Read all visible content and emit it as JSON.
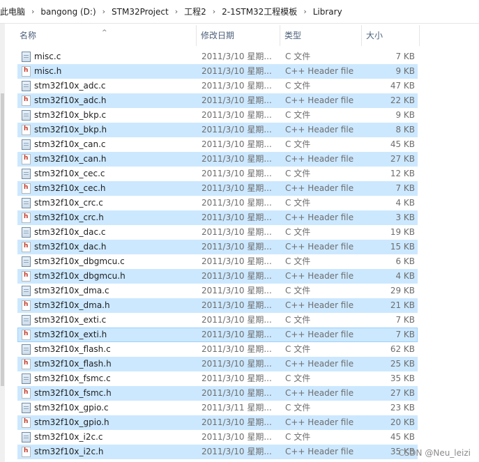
{
  "breadcrumb": [
    "此电脑",
    "bangong (D:)",
    "STM32Project",
    "工程2",
    "2-1STM32工程模板",
    "Library"
  ],
  "columns": {
    "name": "名称",
    "date": "修改日期",
    "type": "类型",
    "size": "大小"
  },
  "files": [
    {
      "name": "misc.c",
      "date": "2011/3/10 星期...",
      "type": "C 文件",
      "size": "7 KB",
      "kind": "c",
      "selected": false
    },
    {
      "name": "misc.h",
      "date": "2011/3/10 星期...",
      "type": "C++ Header file",
      "size": "9 KB",
      "kind": "h",
      "selected": true
    },
    {
      "name": "stm32f10x_adc.c",
      "date": "2011/3/10 星期...",
      "type": "C 文件",
      "size": "47 KB",
      "kind": "c",
      "selected": false
    },
    {
      "name": "stm32f10x_adc.h",
      "date": "2011/3/10 星期...",
      "type": "C++ Header file",
      "size": "22 KB",
      "kind": "h",
      "selected": true
    },
    {
      "name": "stm32f10x_bkp.c",
      "date": "2011/3/10 星期...",
      "type": "C 文件",
      "size": "9 KB",
      "kind": "c",
      "selected": false
    },
    {
      "name": "stm32f10x_bkp.h",
      "date": "2011/3/10 星期...",
      "type": "C++ Header file",
      "size": "8 KB",
      "kind": "h",
      "selected": true
    },
    {
      "name": "stm32f10x_can.c",
      "date": "2011/3/10 星期...",
      "type": "C 文件",
      "size": "45 KB",
      "kind": "c",
      "selected": false
    },
    {
      "name": "stm32f10x_can.h",
      "date": "2011/3/10 星期...",
      "type": "C++ Header file",
      "size": "27 KB",
      "kind": "h",
      "selected": true
    },
    {
      "name": "stm32f10x_cec.c",
      "date": "2011/3/10 星期...",
      "type": "C 文件",
      "size": "12 KB",
      "kind": "c",
      "selected": false
    },
    {
      "name": "stm32f10x_cec.h",
      "date": "2011/3/10 星期...",
      "type": "C++ Header file",
      "size": "7 KB",
      "kind": "h",
      "selected": true
    },
    {
      "name": "stm32f10x_crc.c",
      "date": "2011/3/10 星期...",
      "type": "C 文件",
      "size": "4 KB",
      "kind": "c",
      "selected": false
    },
    {
      "name": "stm32f10x_crc.h",
      "date": "2011/3/10 星期...",
      "type": "C++ Header file",
      "size": "3 KB",
      "kind": "h",
      "selected": true
    },
    {
      "name": "stm32f10x_dac.c",
      "date": "2011/3/10 星期...",
      "type": "C 文件",
      "size": "19 KB",
      "kind": "c",
      "selected": false
    },
    {
      "name": "stm32f10x_dac.h",
      "date": "2011/3/10 星期...",
      "type": "C++ Header file",
      "size": "15 KB",
      "kind": "h",
      "selected": true
    },
    {
      "name": "stm32f10x_dbgmcu.c",
      "date": "2011/3/10 星期...",
      "type": "C 文件",
      "size": "6 KB",
      "kind": "c",
      "selected": false
    },
    {
      "name": "stm32f10x_dbgmcu.h",
      "date": "2011/3/10 星期...",
      "type": "C++ Header file",
      "size": "4 KB",
      "kind": "h",
      "selected": true
    },
    {
      "name": "stm32f10x_dma.c",
      "date": "2011/3/10 星期...",
      "type": "C 文件",
      "size": "29 KB",
      "kind": "c",
      "selected": false
    },
    {
      "name": "stm32f10x_dma.h",
      "date": "2011/3/10 星期...",
      "type": "C++ Header file",
      "size": "21 KB",
      "kind": "h",
      "selected": true
    },
    {
      "name": "stm32f10x_exti.c",
      "date": "2011/3/10 星期...",
      "type": "C 文件",
      "size": "7 KB",
      "kind": "c",
      "selected": false
    },
    {
      "name": "stm32f10x_exti.h",
      "date": "2011/3/10 星期...",
      "type": "C++ Header file",
      "size": "7 KB",
      "kind": "h",
      "selected": true,
      "focused": true
    },
    {
      "name": "stm32f10x_flash.c",
      "date": "2011/3/10 星期...",
      "type": "C 文件",
      "size": "62 KB",
      "kind": "c",
      "selected": false
    },
    {
      "name": "stm32f10x_flash.h",
      "date": "2011/3/10 星期...",
      "type": "C++ Header file",
      "size": "25 KB",
      "kind": "h",
      "selected": true
    },
    {
      "name": "stm32f10x_fsmc.c",
      "date": "2011/3/10 星期...",
      "type": "C 文件",
      "size": "35 KB",
      "kind": "c",
      "selected": false
    },
    {
      "name": "stm32f10x_fsmc.h",
      "date": "2011/3/10 星期...",
      "type": "C++ Header file",
      "size": "27 KB",
      "kind": "h",
      "selected": true
    },
    {
      "name": "stm32f10x_gpio.c",
      "date": "2011/3/11 星期...",
      "type": "C 文件",
      "size": "23 KB",
      "kind": "c",
      "selected": false
    },
    {
      "name": "stm32f10x_gpio.h",
      "date": "2011/3/10 星期...",
      "type": "C++ Header file",
      "size": "20 KB",
      "kind": "h",
      "selected": true
    },
    {
      "name": "stm32f10x_i2c.c",
      "date": "2011/3/10 星期...",
      "type": "C 文件",
      "size": "45 KB",
      "kind": "c",
      "selected": false
    },
    {
      "name": "stm32f10x_i2c.h",
      "date": "2011/3/10 星期...",
      "type": "C++ Header file",
      "size": "35 KB",
      "kind": "h",
      "selected": true
    }
  ],
  "watermark": "CSDN @Neu_leizi",
  "colors": {
    "selection": "#cce8ff",
    "header_text": "#4c607a",
    "secondary_text": "#6d6d6d"
  }
}
